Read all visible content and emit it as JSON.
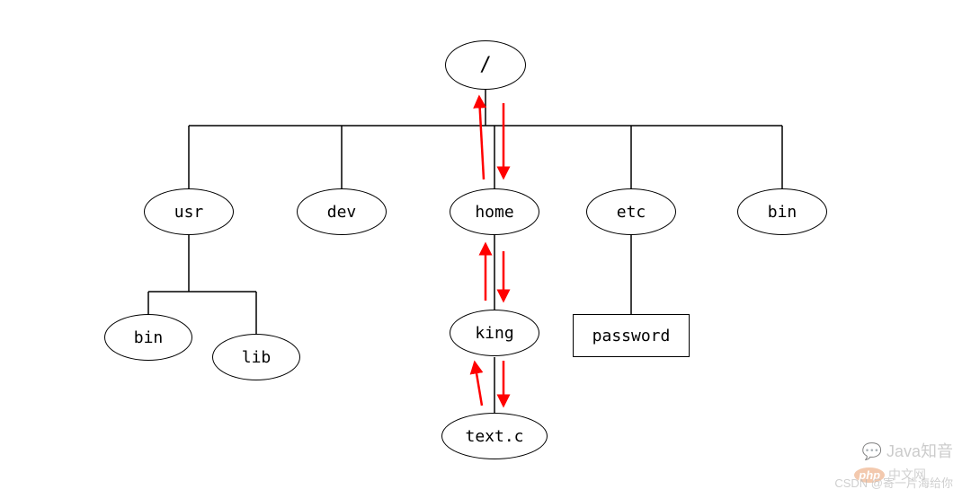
{
  "diagram_type": "tree",
  "description": "Linux filesystem hierarchy tree diagram with red arrows showing traversal path between root and text.c via home/king",
  "nodes": {
    "root": {
      "label": "/",
      "shape": "ellipse"
    },
    "usr": {
      "label": "usr",
      "shape": "ellipse"
    },
    "dev": {
      "label": "dev",
      "shape": "ellipse"
    },
    "home": {
      "label": "home",
      "shape": "ellipse"
    },
    "etc": {
      "label": "etc",
      "shape": "ellipse"
    },
    "bin_top": {
      "label": "bin",
      "shape": "ellipse"
    },
    "bin_sub": {
      "label": "bin",
      "shape": "ellipse"
    },
    "lib": {
      "label": "lib",
      "shape": "ellipse"
    },
    "king": {
      "label": "king",
      "shape": "ellipse"
    },
    "textc": {
      "label": "text.c",
      "shape": "ellipse"
    },
    "password": {
      "label": "password",
      "shape": "rect"
    }
  },
  "edges": [
    [
      "root",
      "usr"
    ],
    [
      "root",
      "dev"
    ],
    [
      "root",
      "home"
    ],
    [
      "root",
      "etc"
    ],
    [
      "root",
      "bin_top"
    ],
    [
      "usr",
      "bin_sub"
    ],
    [
      "usr",
      "lib"
    ],
    [
      "home",
      "king"
    ],
    [
      "king",
      "textc"
    ],
    [
      "etc",
      "password"
    ]
  ],
  "highlighted_path": [
    "root",
    "home",
    "king",
    "textc"
  ],
  "arrow_direction": "bidirectional",
  "arrow_color": "#ff0000",
  "watermarks": {
    "java": "Java知音",
    "csdn": "CSDN @寄一片海给你",
    "php_badge": "php",
    "php_text": "中文网"
  }
}
